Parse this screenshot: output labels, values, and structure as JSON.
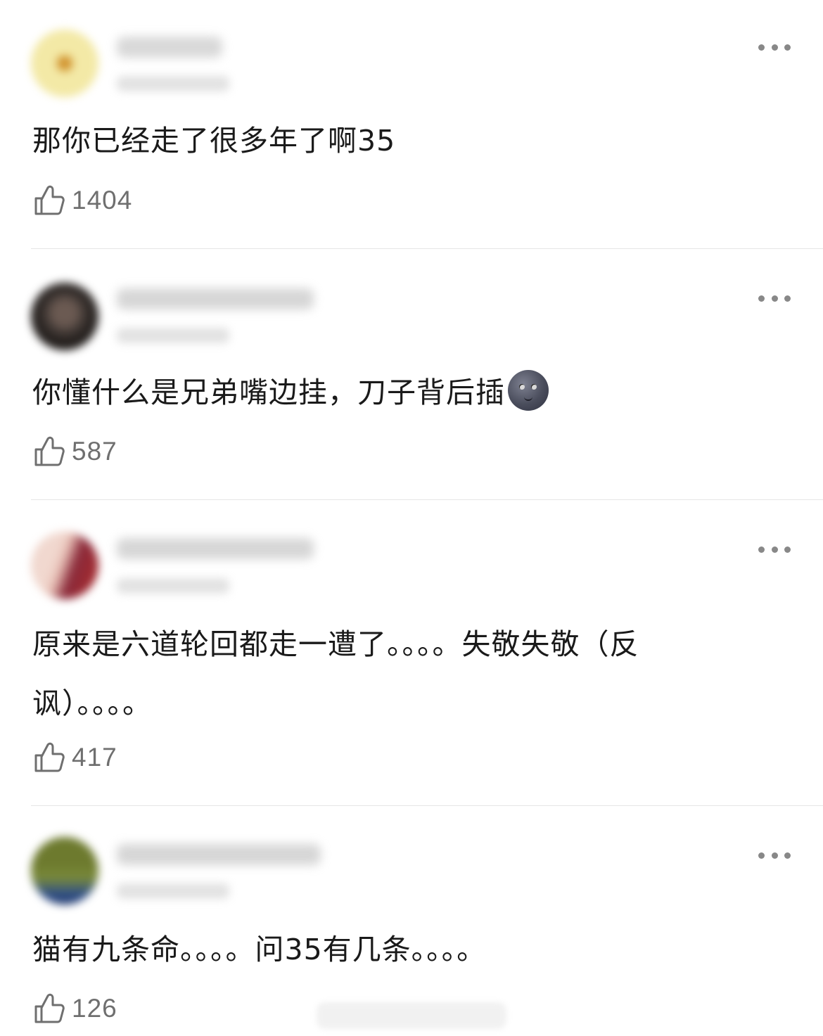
{
  "comments": [
    {
      "text": "那你已经走了很多年了啊35",
      "likes": "1404",
      "avatar_color": "#f3e9a6",
      "avatar_accent": "#d0902a"
    },
    {
      "text": "你懂什么是兄弟嘴边挂，刀子背后插",
      "emoji": "new-moon-face-icon",
      "likes": "587",
      "avatar_color": "#3a3330",
      "avatar_accent": "#1c1816"
    },
    {
      "text": "原来是六道轮回都走一遭了。。。。失敬失敬（反讽）。。。。",
      "likes": "417",
      "avatar_color": "#e9c2b8",
      "avatar_accent": "#b02a2a"
    },
    {
      "text": "猫有九条命。。。。问35有几条。。。。",
      "likes": "126",
      "avatar_color": "#7a8a3a",
      "avatar_accent": "#2f4f8a"
    }
  ],
  "icons": {
    "like": "thumbs-up-icon",
    "more": "more-dots-icon"
  },
  "colors": {
    "text": "#1a1a1a",
    "count": "#6f6f6f",
    "divider": "#e6e6e6",
    "dots": "#888888"
  }
}
